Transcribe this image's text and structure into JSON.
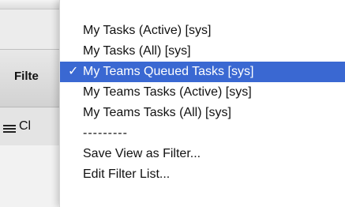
{
  "background": {
    "filter_label": "Filte",
    "class_label": "Cl"
  },
  "menu": {
    "items": [
      {
        "label": "My Tasks (Active) [sys]"
      },
      {
        "label": "My Tasks (All) [sys]"
      },
      {
        "label": "My Teams Queued Tasks [sys]",
        "selected": true,
        "check": "✓"
      },
      {
        "label": "My Teams Tasks (Active) [sys]"
      },
      {
        "label": "My Teams Tasks (All) [sys]"
      }
    ],
    "separator": "---------",
    "actions": [
      {
        "label": "Save View as Filter..."
      },
      {
        "label": "Edit Filter List..."
      }
    ]
  },
  "colors": {
    "selected_bg": "#3a68d2",
    "selected_fg": "#ffffff"
  }
}
